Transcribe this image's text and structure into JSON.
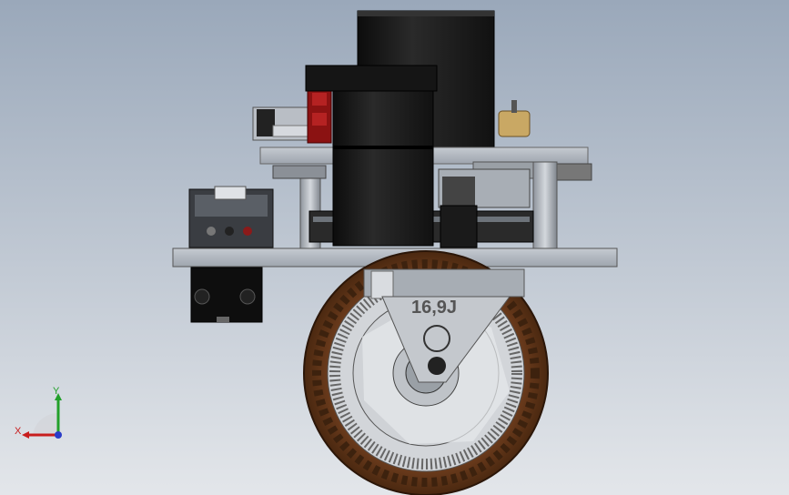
{
  "viewport": {
    "background_top": "#9aa8ba",
    "background_bottom": "#e3e6ea"
  },
  "model": {
    "wheel_marking": "16,9J"
  },
  "triad": {
    "x_label": "X",
    "y_label": "Y",
    "x_color": "#c81e1e",
    "y_color": "#22a02a",
    "z_color": "#2a3cc8"
  }
}
